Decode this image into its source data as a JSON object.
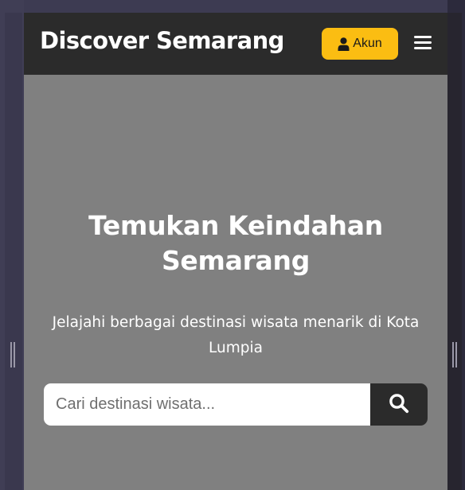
{
  "navbar": {
    "brand": "Discover Semarang",
    "account_label": "Akun",
    "account_icon": "user-icon",
    "menu_icon": "hamburger-menu-icon",
    "account_color": "#fbbd12",
    "bar_color": "#2b2b2b"
  },
  "hero": {
    "title": "Temukan Keindahan Semarang",
    "subtitle": "Jelajahi berbagai destinasi wisata menarik di Kota Lumpia",
    "background_color": "#808080"
  },
  "search": {
    "placeholder": "Cari destinasi wisata...",
    "value": "",
    "button_icon": "search-icon"
  }
}
